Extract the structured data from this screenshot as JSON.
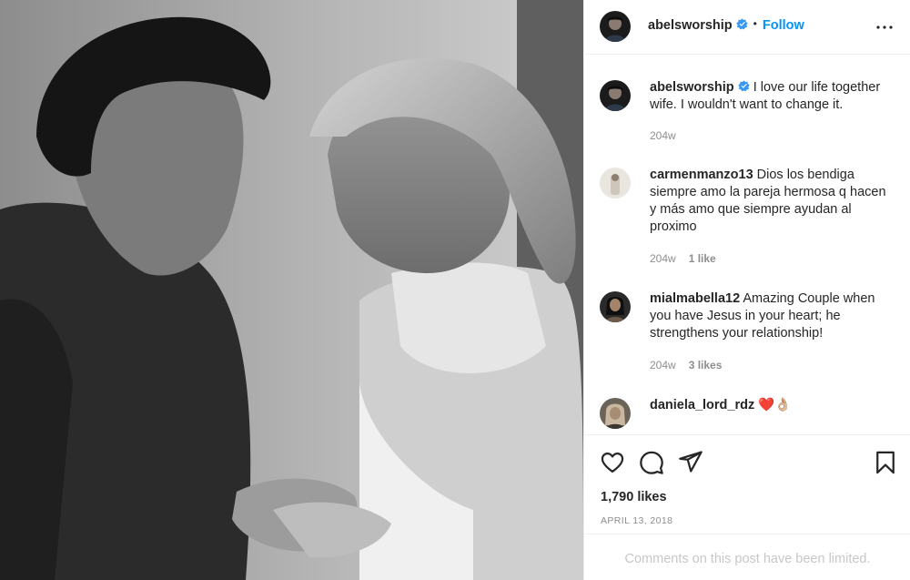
{
  "post": {
    "image_alt": "Black and white photo of a couple holding hands",
    "author": {
      "username": "abelsworship",
      "verified": true
    },
    "follow_label": "Follow",
    "separator": "•"
  },
  "comments": [
    {
      "username": "abelsworship",
      "verified": true,
      "text": "I love our life together wife. I wouldn't want to change it.",
      "time": "204w",
      "likes": ""
    },
    {
      "username": "carmenmanzo13",
      "verified": false,
      "text": "Dios los bendiga siempre amo la pareja hermosa q hacen y más amo que siempre ayudan al proximo",
      "time": "204w",
      "likes": "1 like"
    },
    {
      "username": "mialmabella12",
      "verified": false,
      "text": "Amazing Couple when you have Jesus in your heart; he strengthens your relationship!",
      "time": "204w",
      "likes": "3 likes"
    },
    {
      "username": "daniela_lord_rdz",
      "verified": false,
      "text": "❤️👌🏼",
      "time": "",
      "likes": ""
    }
  ],
  "actions": {
    "like_icon": "heart-outline-icon",
    "comment_icon": "comment-bubble-icon",
    "share_icon": "paper-plane-icon",
    "save_icon": "bookmark-icon"
  },
  "likes_count": "1,790 likes",
  "date": "APRIL 13, 2018",
  "comments_limited": "Comments on this post have been limited.",
  "colors": {
    "accent": "#0095f6",
    "text": "#262626",
    "muted": "#8e8e8e",
    "border": "#efefef",
    "heart": "#ed4956"
  }
}
